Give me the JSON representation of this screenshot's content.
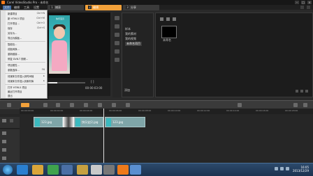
{
  "window": {
    "title": "Corel VideoStudio Pro - 未命名"
  },
  "menubar": {
    "items": [
      "文件",
      "编辑",
      "工具",
      "设置"
    ]
  },
  "steps": [
    {
      "num": "1",
      "label": "捕获"
    },
    {
      "num": "2",
      "label": "编辑"
    },
    {
      "num": "3",
      "label": "分享"
    }
  ],
  "file_menu": {
    "items": [
      {
        "label": "新建项目",
        "shortcut": "Ctrl+N"
      },
      {
        "label": "新 HTML5 项目",
        "shortcut": "Ctrl+M"
      },
      {
        "label": "打开项目...",
        "shortcut": "Ctrl+O"
      },
      {
        "label": "保存",
        "shortcut": "Ctrl+S"
      },
      {
        "label": "另存为...",
        "shortcut": ""
      },
      {
        "label": "导出为模板...",
        "shortcut": ""
      },
      {
        "label": "智能包...",
        "shortcut": ""
      },
      {
        "label": "成批转换...",
        "shortcut": ""
      },
      {
        "label": "重新链接...",
        "shortcut": ""
      },
      {
        "label": "修复 DVB-T 视频...",
        "shortcut": ""
      },
      {
        "label": "项目属性...",
        "shortcut": ""
      },
      {
        "label": "参数选择...",
        "shortcut": "F6"
      },
      {
        "label": "将媒体文件插入到时间轴",
        "shortcut": ""
      },
      {
        "label": "将媒体文件插入到素材库",
        "shortcut": ""
      },
      {
        "label": "打开 HTML5 项目",
        "shortcut": ""
      },
      {
        "label": "最近打开项目",
        "shortcut": ""
      },
      {
        "label": "退出",
        "shortcut": ""
      }
    ]
  },
  "preview": {
    "timecode": "00:00:03:00",
    "photo_text": "快乐宝贝"
  },
  "library": {
    "tree": [
      "样本",
      "我的素材",
      "我的视频",
      "未命名项目"
    ],
    "selected_index": 3,
    "add_label": "添加",
    "thumb_name": "未命名"
  },
  "timeline": {
    "ruler": [
      "00:00:00:00",
      "00:00:02:00",
      "00:00:04:00",
      "00:00:06:00",
      "00:00:08:00",
      "00:00:10:00",
      "00:00:12:00",
      "00:00:14:00",
      "00:00:16:00",
      "00:00:18:00"
    ],
    "clips": [
      "123.jpg",
      "快乐宝贝.jpg",
      "123.jpg"
    ]
  },
  "taskbar": {
    "time": "16:05",
    "date": "2013/12/29"
  }
}
